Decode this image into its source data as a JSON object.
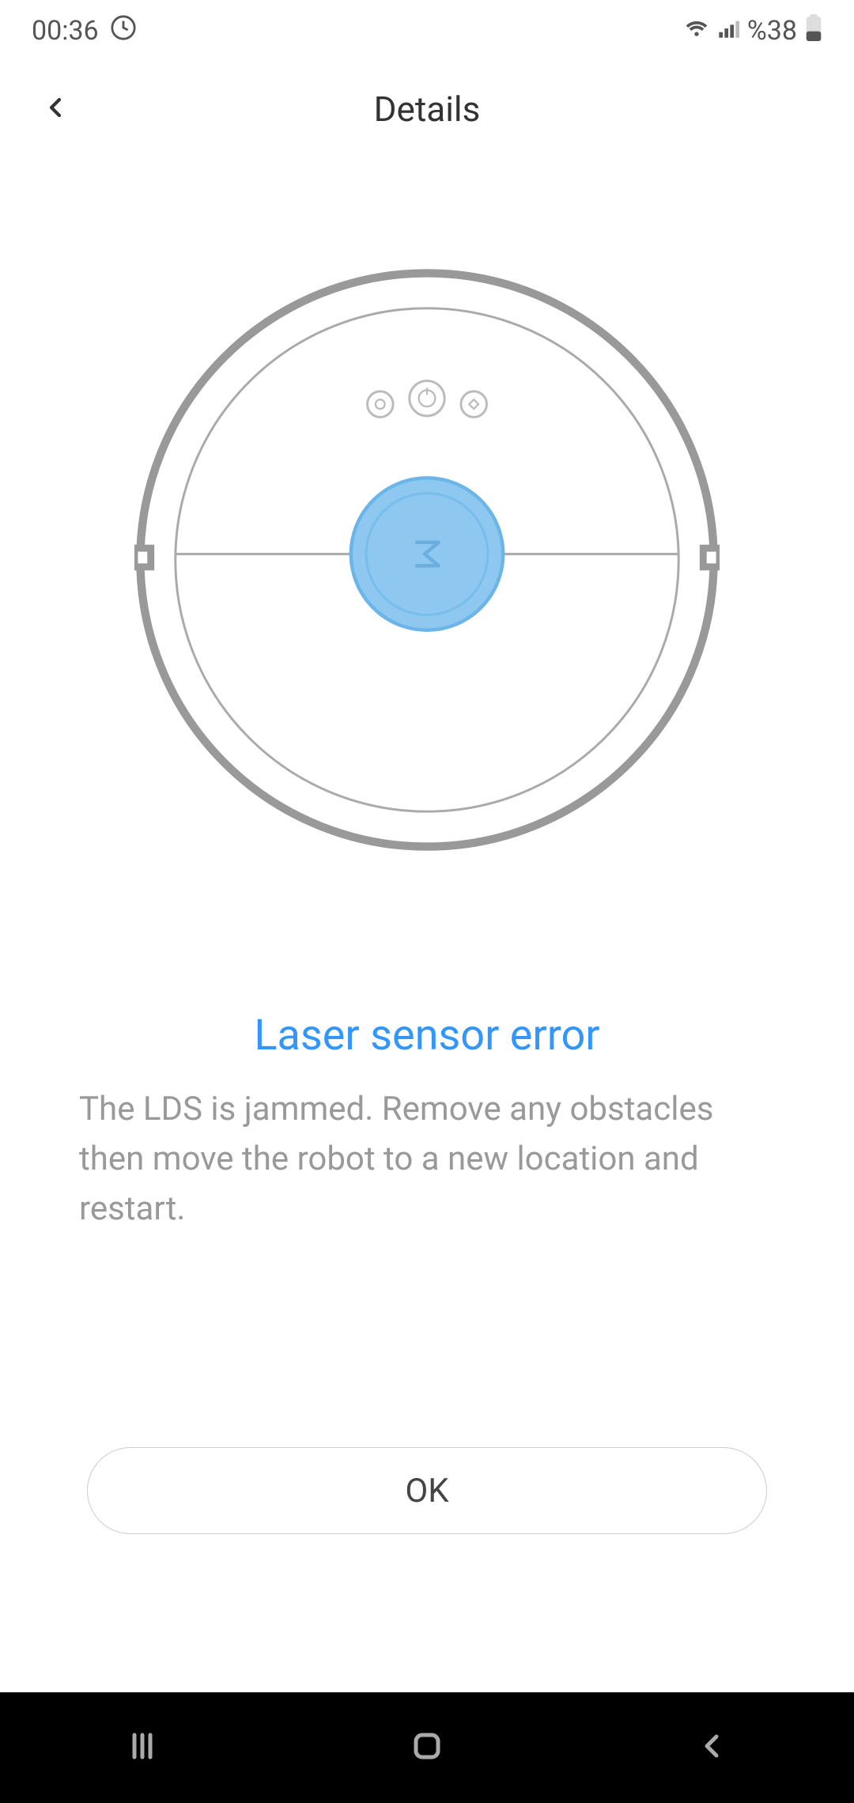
{
  "statusBar": {
    "time": "00:36",
    "battery": "%38"
  },
  "header": {
    "title": "Details"
  },
  "error": {
    "title": "Laser sensor error",
    "description": "The LDS is jammed. Remove any obstacles then move the robot to a new location and restart."
  },
  "button": {
    "ok": "OK"
  }
}
